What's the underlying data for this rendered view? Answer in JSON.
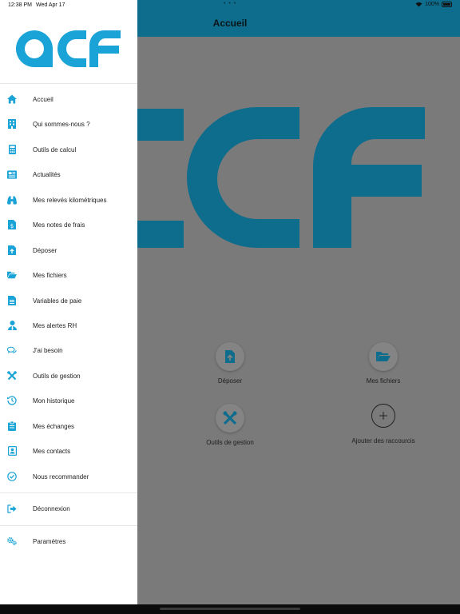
{
  "status_bar": {
    "time": "12:38 PM",
    "date": "Wed Apr 17",
    "dots": "• • •",
    "battery": "100%"
  },
  "header": {
    "title": "Accueil"
  },
  "brand": {
    "logo_text": "acf",
    "accent_color": "#1aa3d6",
    "dim_accent_color": "#0e6d8c"
  },
  "drawer": {
    "items": [
      {
        "label": "Accueil",
        "icon": "home-icon"
      },
      {
        "label": "Qui sommes-nous ?",
        "icon": "building-icon"
      },
      {
        "label": "Outils de calcul",
        "icon": "calculator-icon"
      },
      {
        "label": "Actualités",
        "icon": "newspaper-icon"
      },
      {
        "label": "Mes relevés kilométriques",
        "icon": "binoculars-icon"
      },
      {
        "label": "Mes notes de frais",
        "icon": "receipt-icon"
      },
      {
        "label": "Déposer",
        "icon": "file-upload-icon"
      },
      {
        "label": "Mes fichiers",
        "icon": "folder-open-icon"
      },
      {
        "label": "Variables de paie",
        "icon": "document-icon"
      },
      {
        "label": "Mes alertes RH",
        "icon": "user-tie-icon"
      },
      {
        "label": "J'ai besoin",
        "icon": "chat-bubbles-icon"
      },
      {
        "label": "Outils de gestion",
        "icon": "tools-icon"
      },
      {
        "label": "Mon historique",
        "icon": "history-icon"
      },
      {
        "label": "Mes échanges",
        "icon": "clipboard-icon"
      },
      {
        "label": "Mes contacts",
        "icon": "contact-card-icon"
      },
      {
        "label": "Nous recommander",
        "icon": "check-circle-icon"
      }
    ],
    "logout": {
      "label": "Déconnexion",
      "icon": "sign-out-icon"
    },
    "settings": {
      "label": "Paramètres",
      "icon": "cogs-icon"
    }
  },
  "shortcuts": [
    {
      "label": "Déposer",
      "icon": "file-upload-icon"
    },
    {
      "label": "Mes fichiers",
      "icon": "folder-open-icon"
    },
    {
      "label": "Outils de gestion",
      "icon": "tools-icon"
    },
    {
      "label": "Ajouter des raccourcis",
      "icon": "plus-icon"
    }
  ]
}
